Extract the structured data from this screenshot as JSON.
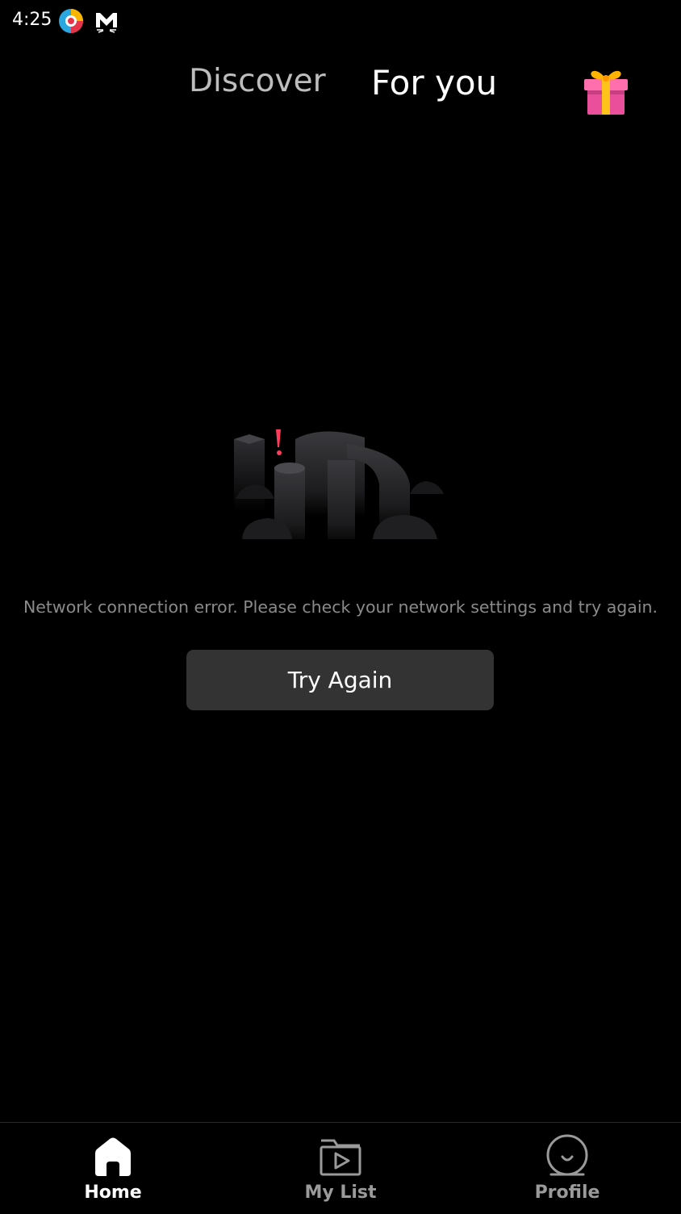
{
  "status_bar": {
    "time": "4:25",
    "icons": [
      "app-logo-icon",
      "mail-icon"
    ]
  },
  "top_tabs": {
    "discover": "Discover",
    "for_you": "For you",
    "gift_icon": "gift-icon"
  },
  "error": {
    "illustration_icon": "network-error-illustration",
    "message": "Network connection error. Please check your network settings and try again.",
    "retry_label": "Try Again"
  },
  "bottom_nav": {
    "items": [
      {
        "label": "Home",
        "icon": "home-icon",
        "active": true
      },
      {
        "label": "My List",
        "icon": "play-folder-icon",
        "active": false
      },
      {
        "label": "Profile",
        "icon": "profile-icon",
        "active": false
      }
    ]
  },
  "colors": {
    "background": "#000000",
    "active_tab": "#ffffff",
    "inactive_tab": "#bdbdbd",
    "button_bg": "#333333",
    "error_text": "#8a8a8a",
    "alert_accent": "#ff3b5c"
  }
}
